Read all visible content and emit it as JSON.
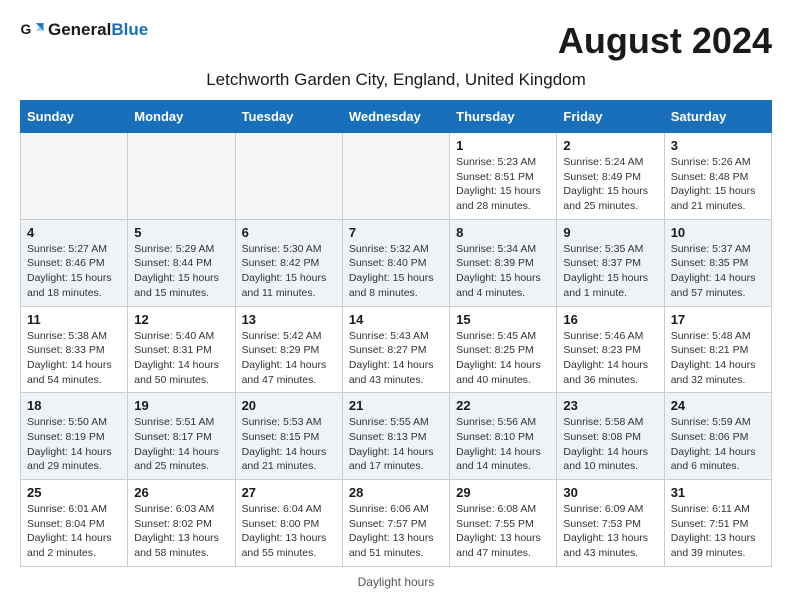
{
  "header": {
    "logo_general": "General",
    "logo_blue": "Blue",
    "month_title": "August 2024",
    "location": "Letchworth Garden City, England, United Kingdom"
  },
  "days_of_week": [
    "Sunday",
    "Monday",
    "Tuesday",
    "Wednesday",
    "Thursday",
    "Friday",
    "Saturday"
  ],
  "weeks": [
    [
      {
        "day": "",
        "sunrise": "",
        "sunset": "",
        "daylight": ""
      },
      {
        "day": "",
        "sunrise": "",
        "sunset": "",
        "daylight": ""
      },
      {
        "day": "",
        "sunrise": "",
        "sunset": "",
        "daylight": ""
      },
      {
        "day": "",
        "sunrise": "",
        "sunset": "",
        "daylight": ""
      },
      {
        "day": "1",
        "sunrise": "5:23 AM",
        "sunset": "8:51 PM",
        "daylight": "15 hours and 28 minutes."
      },
      {
        "day": "2",
        "sunrise": "5:24 AM",
        "sunset": "8:49 PM",
        "daylight": "15 hours and 25 minutes."
      },
      {
        "day": "3",
        "sunrise": "5:26 AM",
        "sunset": "8:48 PM",
        "daylight": "15 hours and 21 minutes."
      }
    ],
    [
      {
        "day": "4",
        "sunrise": "5:27 AM",
        "sunset": "8:46 PM",
        "daylight": "15 hours and 18 minutes."
      },
      {
        "day": "5",
        "sunrise": "5:29 AM",
        "sunset": "8:44 PM",
        "daylight": "15 hours and 15 minutes."
      },
      {
        "day": "6",
        "sunrise": "5:30 AM",
        "sunset": "8:42 PM",
        "daylight": "15 hours and 11 minutes."
      },
      {
        "day": "7",
        "sunrise": "5:32 AM",
        "sunset": "8:40 PM",
        "daylight": "15 hours and 8 minutes."
      },
      {
        "day": "8",
        "sunrise": "5:34 AM",
        "sunset": "8:39 PM",
        "daylight": "15 hours and 4 minutes."
      },
      {
        "day": "9",
        "sunrise": "5:35 AM",
        "sunset": "8:37 PM",
        "daylight": "15 hours and 1 minute."
      },
      {
        "day": "10",
        "sunrise": "5:37 AM",
        "sunset": "8:35 PM",
        "daylight": "14 hours and 57 minutes."
      }
    ],
    [
      {
        "day": "11",
        "sunrise": "5:38 AM",
        "sunset": "8:33 PM",
        "daylight": "14 hours and 54 minutes."
      },
      {
        "day": "12",
        "sunrise": "5:40 AM",
        "sunset": "8:31 PM",
        "daylight": "14 hours and 50 minutes."
      },
      {
        "day": "13",
        "sunrise": "5:42 AM",
        "sunset": "8:29 PM",
        "daylight": "14 hours and 47 minutes."
      },
      {
        "day": "14",
        "sunrise": "5:43 AM",
        "sunset": "8:27 PM",
        "daylight": "14 hours and 43 minutes."
      },
      {
        "day": "15",
        "sunrise": "5:45 AM",
        "sunset": "8:25 PM",
        "daylight": "14 hours and 40 minutes."
      },
      {
        "day": "16",
        "sunrise": "5:46 AM",
        "sunset": "8:23 PM",
        "daylight": "14 hours and 36 minutes."
      },
      {
        "day": "17",
        "sunrise": "5:48 AM",
        "sunset": "8:21 PM",
        "daylight": "14 hours and 32 minutes."
      }
    ],
    [
      {
        "day": "18",
        "sunrise": "5:50 AM",
        "sunset": "8:19 PM",
        "daylight": "14 hours and 29 minutes."
      },
      {
        "day": "19",
        "sunrise": "5:51 AM",
        "sunset": "8:17 PM",
        "daylight": "14 hours and 25 minutes."
      },
      {
        "day": "20",
        "sunrise": "5:53 AM",
        "sunset": "8:15 PM",
        "daylight": "14 hours and 21 minutes."
      },
      {
        "day": "21",
        "sunrise": "5:55 AM",
        "sunset": "8:13 PM",
        "daylight": "14 hours and 17 minutes."
      },
      {
        "day": "22",
        "sunrise": "5:56 AM",
        "sunset": "8:10 PM",
        "daylight": "14 hours and 14 minutes."
      },
      {
        "day": "23",
        "sunrise": "5:58 AM",
        "sunset": "8:08 PM",
        "daylight": "14 hours and 10 minutes."
      },
      {
        "day": "24",
        "sunrise": "5:59 AM",
        "sunset": "8:06 PM",
        "daylight": "14 hours and 6 minutes."
      }
    ],
    [
      {
        "day": "25",
        "sunrise": "6:01 AM",
        "sunset": "8:04 PM",
        "daylight": "14 hours and 2 minutes."
      },
      {
        "day": "26",
        "sunrise": "6:03 AM",
        "sunset": "8:02 PM",
        "daylight": "13 hours and 58 minutes."
      },
      {
        "day": "27",
        "sunrise": "6:04 AM",
        "sunset": "8:00 PM",
        "daylight": "13 hours and 55 minutes."
      },
      {
        "day": "28",
        "sunrise": "6:06 AM",
        "sunset": "7:57 PM",
        "daylight": "13 hours and 51 minutes."
      },
      {
        "day": "29",
        "sunrise": "6:08 AM",
        "sunset": "7:55 PM",
        "daylight": "13 hours and 47 minutes."
      },
      {
        "day": "30",
        "sunrise": "6:09 AM",
        "sunset": "7:53 PM",
        "daylight": "13 hours and 43 minutes."
      },
      {
        "day": "31",
        "sunrise": "6:11 AM",
        "sunset": "7:51 PM",
        "daylight": "13 hours and 39 minutes."
      }
    ]
  ],
  "footer": {
    "note": "Daylight hours"
  }
}
